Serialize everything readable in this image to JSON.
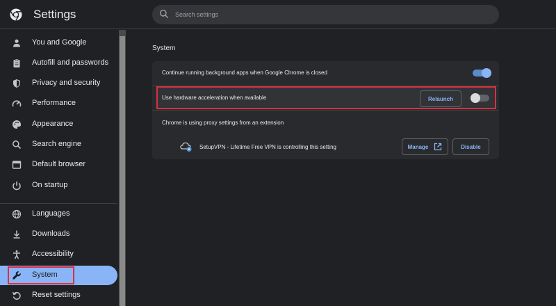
{
  "header": {
    "title": "Settings",
    "search_placeholder": "Search settings"
  },
  "sidebar": {
    "items": [
      {
        "label": "You and Google",
        "icon": "person-icon"
      },
      {
        "label": "Autofill and passwords",
        "icon": "clipboard-icon"
      },
      {
        "label": "Privacy and security",
        "icon": "shield-icon"
      },
      {
        "label": "Performance",
        "icon": "speedometer-icon"
      },
      {
        "label": "Appearance",
        "icon": "palette-icon"
      },
      {
        "label": "Search engine",
        "icon": "search-icon"
      },
      {
        "label": "Default browser",
        "icon": "browser-icon"
      },
      {
        "label": "On startup",
        "icon": "power-icon"
      },
      {
        "label": "Languages",
        "icon": "globe-icon"
      },
      {
        "label": "Downloads",
        "icon": "download-icon"
      },
      {
        "label": "Accessibility",
        "icon": "accessibility-icon"
      },
      {
        "label": "System",
        "icon": "wrench-icon",
        "active": true
      },
      {
        "label": "Reset settings",
        "icon": "reset-icon"
      }
    ]
  },
  "main": {
    "section_title": "System",
    "background_apps": {
      "label": "Continue running background apps when Google Chrome is closed",
      "enabled": true
    },
    "hardware_acceleration": {
      "label": "Use hardware acceleration when available",
      "relaunch_label": "Relaunch",
      "enabled": false
    },
    "proxy": {
      "label": "Chrome is using proxy settings from an extension",
      "extension_text": "SetupVPN - Lifetime Free VPN is controlling this setting",
      "manage_label": "Manage",
      "disable_label": "Disable"
    }
  },
  "colors": {
    "background": "#202124",
    "card": "#292a2d",
    "accent": "#8ab4f8",
    "highlight_border": "#d93040"
  }
}
